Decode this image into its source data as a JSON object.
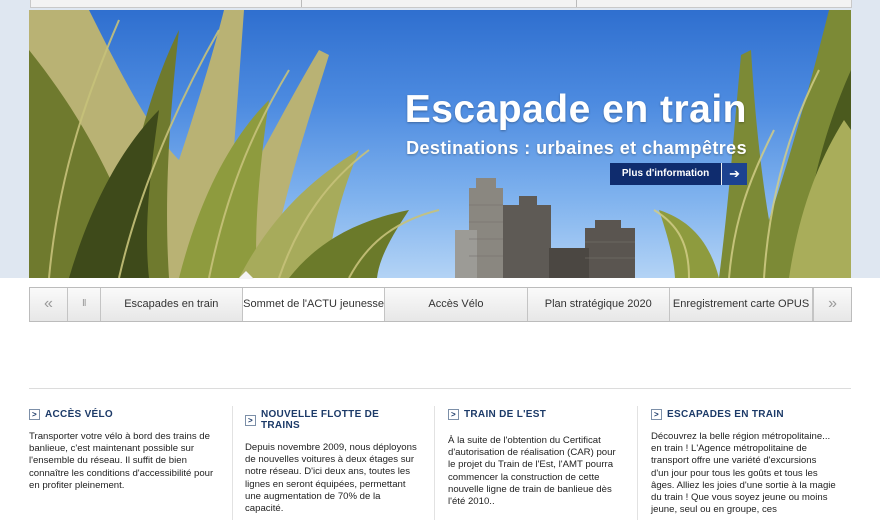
{
  "hero": {
    "title": "Escapade en train",
    "subtitle": "Destinations : urbaines et champêtres",
    "button_label": "Plus d'information",
    "button_icon": "arrow-right-icon"
  },
  "carousel_tabs": {
    "prev_icon": "«",
    "pause_icon": "II",
    "next_icon": "»",
    "items": [
      "Escapades en train",
      "Sommet de l'ACTU jeunesse",
      "Accès Vélo",
      "Plan stratégique 2020",
      "Enregistrement carte OPUS"
    ],
    "active_index": 1
  },
  "news": [
    {
      "title": "ACCÈS VÉLO",
      "text": "Transporter votre vélo à bord des trains de banlieue, c'est maintenant possible sur l'ensemble du réseau. Il suffit de bien connaître les conditions d'accessibilité pour en profiter pleinement."
    },
    {
      "title": "NOUVELLE FLOTTE DE TRAINS",
      "text": "Depuis novembre 2009, nous déployons de nouvelles voitures à deux étages sur notre réseau. D'ici deux ans, toutes les lignes en seront équipées, permettant une augmentation de 70% de la capacité."
    },
    {
      "title": "TRAIN DE L'EST",
      "text": "À la suite de l'obtention du Certificat d'autorisation de réalisation (CAR) pour le projet du Train de l'Est, l'AMT pourra commencer la construction de cette nouvelle ligne de train de banlieue dès l'été 2010.."
    },
    {
      "title": "ESCAPADES EN TRAIN",
      "text": "Découvrez la belle région métropolitaine... en train ! L'Agence métropolitaine de transport offre une variété d'excursions d'un jour pour tous les goûts et tous les âges. Alliez les joies d'une sortie à la magie du train ! Que vous soyez jeune ou moins jeune, seul ou en groupe, ces"
    }
  ],
  "colors": {
    "nav_dark": "#0f2c6e",
    "heading": "#1c3a68"
  }
}
